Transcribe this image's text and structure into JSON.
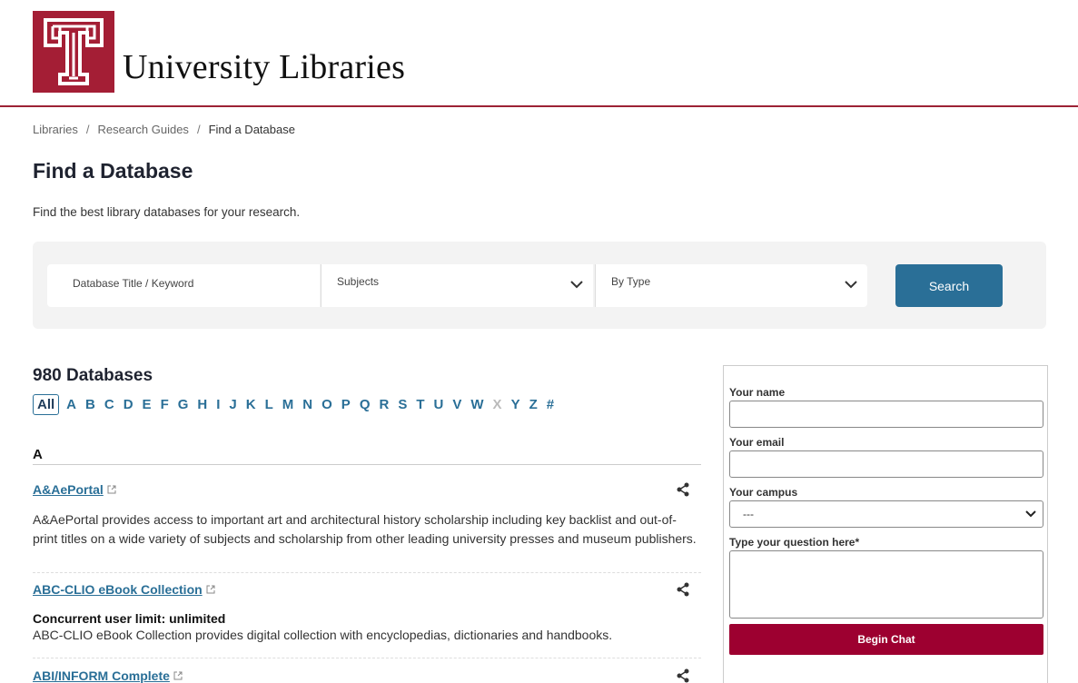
{
  "header": {
    "site_name": "University Libraries",
    "logo_alt": "Temple T logo",
    "brand_color": "#a41e35"
  },
  "breadcrumb": {
    "items": [
      "Libraries",
      "Research Guides"
    ],
    "current": "Find a Database",
    "separator": "/"
  },
  "page": {
    "title": "Find a Database",
    "intro": "Find the best library databases for your research."
  },
  "search": {
    "keyword_placeholder": "Database Title / Keyword",
    "subjects_label": "Subjects",
    "type_label": "By Type",
    "button_label": "Search",
    "button_color": "#2a6f97"
  },
  "results": {
    "count_label": "980 Databases",
    "alphabet": [
      "All",
      "A",
      "B",
      "C",
      "D",
      "E",
      "F",
      "G",
      "H",
      "I",
      "J",
      "K",
      "L",
      "M",
      "N",
      "O",
      "P",
      "Q",
      "R",
      "S",
      "T",
      "U",
      "V",
      "W",
      "X",
      "Y",
      "Z",
      "#"
    ],
    "alphabet_disabled": [
      "X"
    ],
    "alphabet_selected": "All",
    "section_letter": "A",
    "entries": [
      {
        "title": "A&AePortal",
        "description": "A&AePortal provides access to important art and architectural history scholarship including key backlist and out-of-print titles on a wide variety of subjects and scholarship from other leading university presses and museum publishers."
      },
      {
        "title": "ABC-CLIO eBook Collection",
        "note": "Concurrent user limit: unlimited",
        "description": "ABC-CLIO eBook Collection provides digital collection with encyclopedias, dictionaries and handbooks."
      },
      {
        "title": "ABI/INFORM Complete"
      }
    ]
  },
  "chat": {
    "name_label": "Your name",
    "email_label": "Your email",
    "campus_label": "Your campus",
    "campus_value": "---",
    "question_label": "Type your question here*",
    "button_label": "Begin Chat",
    "button_color": "#9d0030"
  }
}
